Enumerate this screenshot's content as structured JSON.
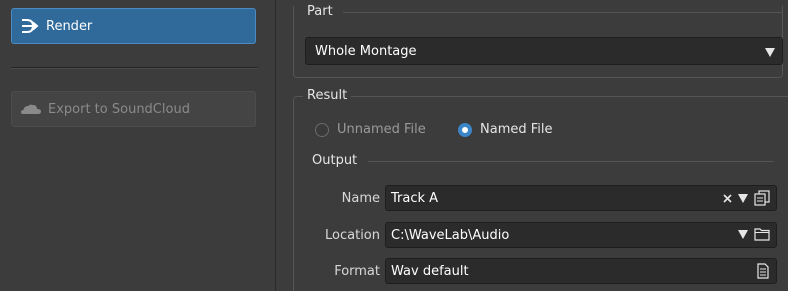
{
  "sidebar": {
    "render_label": "Render",
    "export_label": "Export to SoundCloud"
  },
  "part": {
    "title": "Part",
    "selected": "Whole Montage"
  },
  "result": {
    "title": "Result",
    "options": [
      {
        "label": "Unnamed File",
        "selected": false
      },
      {
        "label": "Named File",
        "selected": true
      }
    ],
    "output_title": "Output",
    "name_label": "Name",
    "name_value": "Track A",
    "location_label": "Location",
    "location_value": "C:\\WaveLab\\Audio",
    "format_label": "Format",
    "format_value": "Wav default"
  },
  "colors": {
    "accent": "#2f6a9a",
    "radio_on": "#3a86c8",
    "background": "#3c3c3c",
    "field_bg": "#2b2b2b"
  }
}
